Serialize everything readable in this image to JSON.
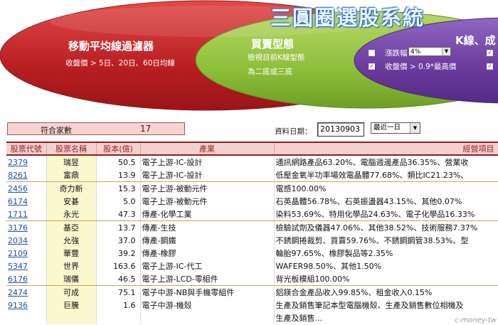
{
  "banner": {
    "title": "三圓圈選股系統",
    "red_circle": {
      "heading": "移動平均線過濾器",
      "sub": "收盤價 > 5日、20日、60日均線"
    },
    "green_circle": {
      "heading": "買賣型態",
      "sub1": "檢視目前K線型態",
      "sub2": "為二底或三底"
    },
    "purple_circle": {
      "heading": "K線、成",
      "option1_label": "漲跌幅",
      "option1_value": "4%",
      "option1_check": "",
      "option2_label": "收盤價 > 0.9*最高價",
      "option2_check": "✓",
      "extra_check": "✓"
    },
    "colors": {
      "red": "#c0292b",
      "green": "#8bbf3c",
      "purple": "#6b3a9c",
      "title": "#2f6fd0"
    }
  },
  "filter": {
    "count_label": "符合家數",
    "count_value": "17",
    "date_label": "資料日期：",
    "date_value": "20130903",
    "range_value": "最近一日"
  },
  "table": {
    "headers": [
      "股票代號",
      "股票名稱",
      "股本(億)",
      "產業",
      "經營項目"
    ],
    "rows": [
      [
        "2379",
        "瑞昱",
        "50.5",
        "電子上游-IC-設計",
        "通訊網路產品63.20%、電腦週邊產品36.35%、營業收"
      ],
      [
        "8261",
        "富鼎",
        "13.9",
        "電子上游-IC-設計",
        "低壓金氧半功率場效電晶體77.68%、類比IC21.23%、"
      ],
      [
        "2456",
        "奇力新",
        "15.3",
        "電子上游-被動元件",
        "電感100.00%"
      ],
      [
        "6174",
        "安碁",
        "5.0",
        "電子上游-被動元件",
        "石英晶體56.78%、石英振盪器43.15%、其他0.07%"
      ],
      [
        "1711",
        "永光",
        "47.3",
        "傳產-化學工業",
        "染料53.69%、特用化學品24.63%、電子化學品16.33%"
      ],
      [
        "3176",
        "基亞",
        "13.7",
        "傳產-生技",
        "檢驗試劑及儀器47.06%、其他38.52%、技術服務7.37%"
      ],
      [
        "2034",
        "允強",
        "37.0",
        "傳產-鋼鐵",
        "不銹鋼捲裁剪、買賣59.76%、不銹鋼鋼管38.53%、型"
      ],
      [
        "2109",
        "華豐",
        "39.2",
        "傳產-橡膠",
        "輪胎97.65%、橡膠製品等2.35%"
      ],
      [
        "5347",
        "世界",
        "163.6",
        "電子上游-IC-代工",
        "WAFER98.50%、其他1.50%"
      ],
      [
        "6176",
        "瑞儀",
        "46.5",
        "電子上游-LCD-零組件",
        "背光板模組100.00%"
      ],
      [
        "2474",
        "可成",
        "75.1",
        "電子中游-NB與手機零組件",
        "鋁鎂合金產品收入99.85%、租金收入0.15%"
      ],
      [
        "9136",
        "巨騰",
        "1.6",
        "電子中游-機殼",
        "生產及銷售筆記本型電腦機殼、生產及銷售數位相機及"
      ],
      [
        "",
        "",
        "",
        "",
        "生產及銷售..."
      ]
    ]
  },
  "watermark": "c-money-tw"
}
